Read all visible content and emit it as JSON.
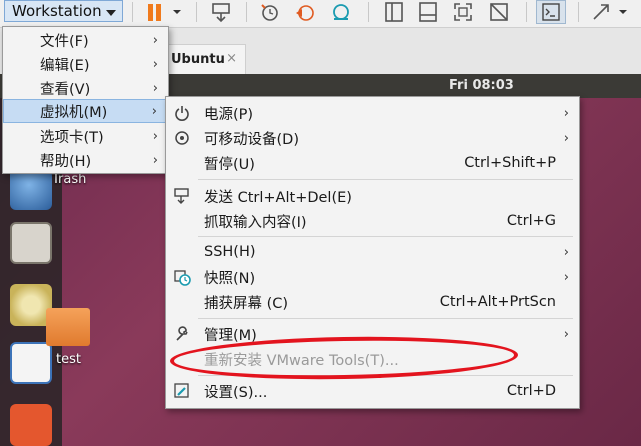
{
  "toolbar": {
    "workstation_label": "Workstation"
  },
  "vm_tab": {
    "title": "Ubuntu",
    "close": "×"
  },
  "guest": {
    "clock": "Fri 08:03",
    "desktop_labels": [
      "Trash",
      "test"
    ]
  },
  "main_menu": {
    "items": [
      {
        "label": "文件(F)"
      },
      {
        "label": "编辑(E)"
      },
      {
        "label": "查看(V)"
      },
      {
        "label": "虚拟机(M)"
      },
      {
        "label": "选项卡(T)"
      },
      {
        "label": "帮助(H)"
      }
    ]
  },
  "vm_menu": {
    "items": [
      {
        "label": "电源(P)",
        "shortcut": ""
      },
      {
        "label": "可移动设备(D)",
        "shortcut": ""
      },
      {
        "label": "暂停(U)",
        "shortcut": "Ctrl+Shift+P"
      },
      {
        "label": "发送 Ctrl+Alt+Del(E)",
        "shortcut": ""
      },
      {
        "label": "抓取输入内容(I)",
        "shortcut": "Ctrl+G"
      },
      {
        "label": "SSH(H)",
        "shortcut": ""
      },
      {
        "label": "快照(N)",
        "shortcut": ""
      },
      {
        "label": "捕获屏幕 (C)",
        "shortcut": "Ctrl+Alt+PrtScn"
      },
      {
        "label": "管理(M)",
        "shortcut": ""
      },
      {
        "label": "重新安装 VMware Tools(T)...",
        "shortcut": ""
      },
      {
        "label": "设置(S)...",
        "shortcut": "Ctrl+D"
      }
    ]
  },
  "colors": {
    "highlight": "#c6dcf3",
    "annotation_red": "#e3141e",
    "pause_orange": "#f07a1c",
    "accent_teal": "#1a9bb0"
  }
}
